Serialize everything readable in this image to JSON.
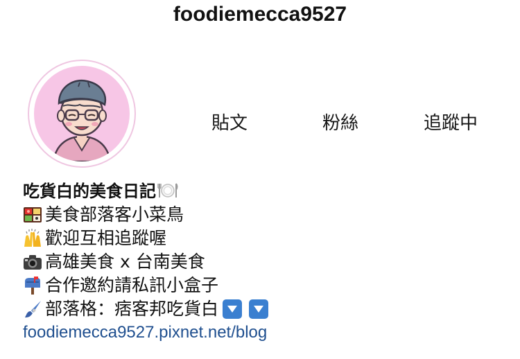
{
  "profile": {
    "username": "foodiemecca9527",
    "avatar_icon": "cartoon-avatar-icon"
  },
  "stats": {
    "posts_label": "貼文",
    "followers_label": "粉絲",
    "following_label": "追蹤中"
  },
  "bio": {
    "name": "吃貨白的美食日記",
    "name_icon": "plate-cutlery-icon",
    "lines": [
      {
        "icon": "bento-box-icon",
        "text": "美食部落客小菜鳥"
      },
      {
        "icon": "raising-hands-icon",
        "text": "歡迎互相追蹤喔"
      },
      {
        "icon": "camera-icon",
        "text": "高雄美食 x 台南美食"
      },
      {
        "icon": "mailbox-icon",
        "text": "合作邀約請私訊小盒子"
      },
      {
        "icon": "paintbrush-icon",
        "text": "部落格：痞客邦吃貨白"
      }
    ],
    "trailing_icons": [
      "down-arrow-button-icon",
      "down-arrow-button-icon"
    ],
    "link": "foodiemecca9527.pixnet.net/blog"
  },
  "colors": {
    "link": "#1f4f8f",
    "avatar_bg": "#f7c6e6",
    "avatar_ring": "#efc6e1",
    "arrow_button": "#3a7fd0"
  }
}
